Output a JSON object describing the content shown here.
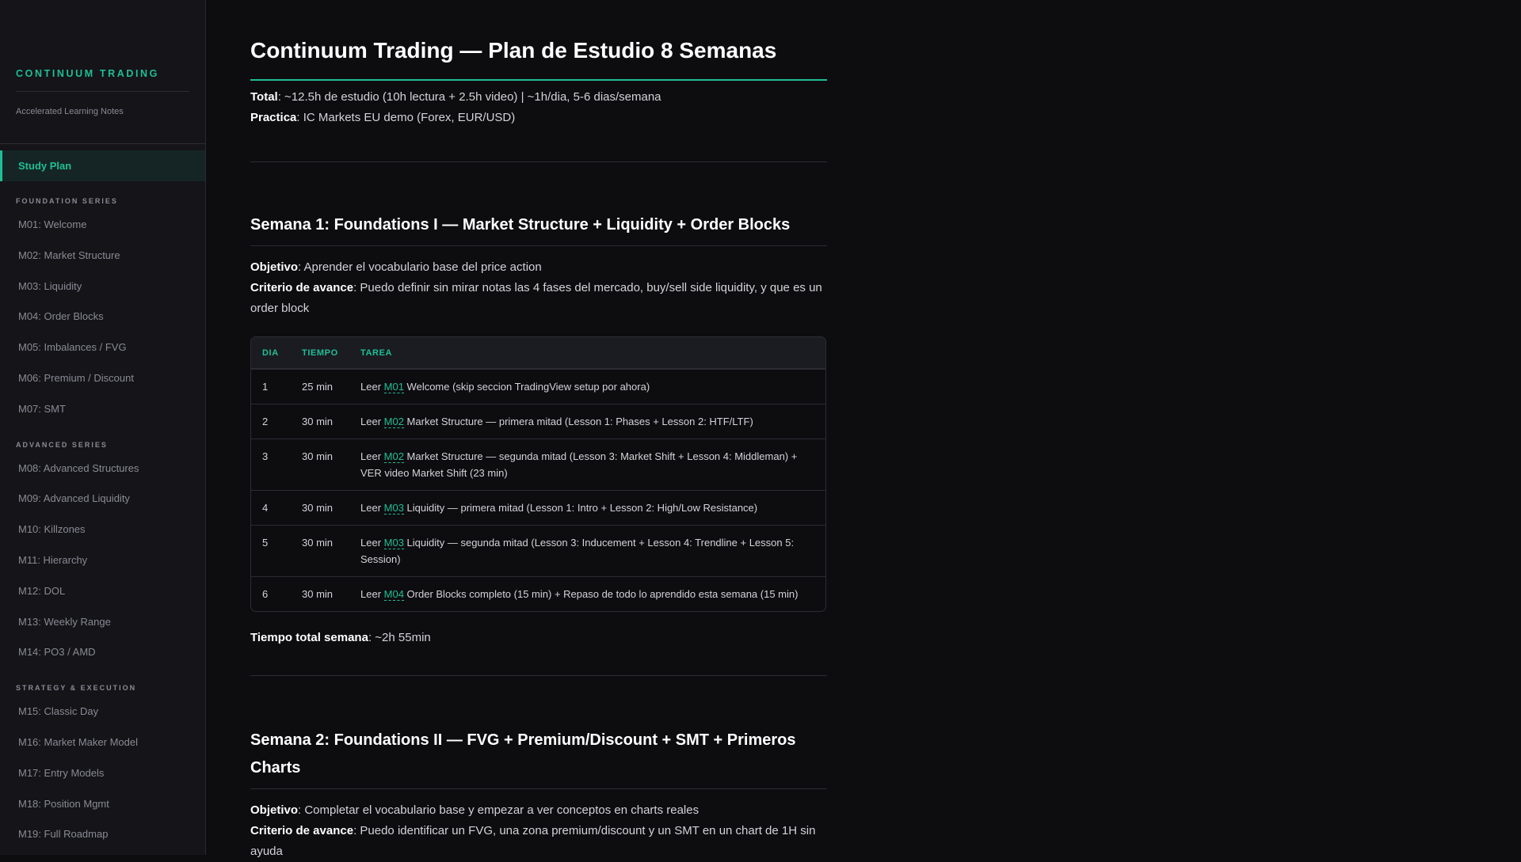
{
  "sidebar": {
    "brand": "CONTINUUM TRADING",
    "tagline": "Accelerated Learning Notes",
    "active": "Study Plan",
    "sections": [
      {
        "title": "FOUNDATION SERIES",
        "items": [
          "M01: Welcome",
          "M02: Market Structure",
          "M03: Liquidity",
          "M04: Order Blocks",
          "M05: Imbalances / FVG",
          "M06: Premium / Discount",
          "M07: SMT"
        ]
      },
      {
        "title": "ADVANCED SERIES",
        "items": [
          "M08: Advanced Structures",
          "M09: Advanced Liquidity",
          "M10: Killzones",
          "M11: Hierarchy",
          "M12: DOL",
          "M13: Weekly Range",
          "M14: PO3 / AMD"
        ]
      },
      {
        "title": "STRATEGY & EXECUTION",
        "items": [
          "M15: Classic Day",
          "M16: Market Maker Model",
          "M17: Entry Models",
          "M18: Position Mgmt",
          "M19: Full Roadmap"
        ]
      }
    ]
  },
  "main": {
    "title": "Continuum Trading — Plan de Estudio 8 Semanas",
    "total_label": "Total",
    "total_value": ": ~12.5h de estudio (10h lectura + 2.5h video) | ~1h/dia, 5-6 dias/semana",
    "practica_label": "Practica",
    "practica_value": ": IC Markets EU demo (Forex, EUR/USD)",
    "week1": {
      "title": "Semana 1: Foundations I — Market Structure + Liquidity + Order Blocks",
      "obj_label": "Objetivo",
      "obj_value": ": Aprender el vocabulario base del price action",
      "crit_label": "Criterio de avance",
      "crit_value": ": Puedo definir sin mirar notas las 4 fases del mercado, buy/sell side liquidity, y que es un order block",
      "headers": [
        "DIA",
        "TIEMPO",
        "TAREA"
      ],
      "rows": [
        {
          "dia": "1",
          "tiempo": "25 min",
          "pre": "Leer ",
          "mod": "M01",
          "rest": " Welcome (skip seccion TradingView setup por ahora)"
        },
        {
          "dia": "2",
          "tiempo": "30 min",
          "pre": "Leer ",
          "mod": "M02",
          "rest": " Market Structure — primera mitad (Lesson 1: Phases + Lesson 2: HTF/LTF)"
        },
        {
          "dia": "3",
          "tiempo": "30 min",
          "pre": "Leer ",
          "mod": "M02",
          "rest": " Market Structure — segunda mitad (Lesson 3: Market Shift + Lesson 4: Middleman) + VER video Market Shift (23 min)"
        },
        {
          "dia": "4",
          "tiempo": "30 min",
          "pre": "Leer ",
          "mod": "M03",
          "rest": " Liquidity — primera mitad (Lesson 1: Intro + Lesson 2: High/Low Resistance)"
        },
        {
          "dia": "5",
          "tiempo": "30 min",
          "pre": "Leer ",
          "mod": "M03",
          "rest": " Liquidity — segunda mitad (Lesson 3: Inducement + Lesson 4: Trendline + Lesson 5: Session)"
        },
        {
          "dia": "6",
          "tiempo": "30 min",
          "pre": "Leer ",
          "mod": "M04",
          "rest": " Order Blocks completo (15 min) + Repaso de todo lo aprendido esta semana (15 min)"
        }
      ],
      "total_label": "Tiempo total semana",
      "total_value": ": ~2h 55min"
    },
    "week2": {
      "title": "Semana 2: Foundations II — FVG + Premium/Discount + SMT + Primeros Charts",
      "obj_label": "Objetivo",
      "obj_value": ": Completar el vocabulario base y empezar a ver conceptos en charts reales",
      "crit_label": "Criterio de avance",
      "crit_value": ": Puedo identificar un FVG, una zona premium/discount y un SMT en un chart de 1H sin ayuda"
    }
  }
}
